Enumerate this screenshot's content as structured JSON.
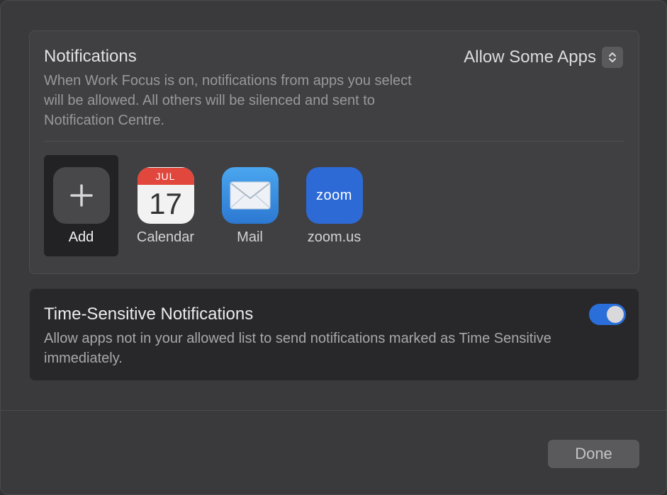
{
  "notifications": {
    "title": "Notifications",
    "description": "When Work Focus is on, notifications from apps you select will be allowed. All others will be silenced and sent to Notification Centre.",
    "mode_label": "Allow Some Apps",
    "apps": [
      {
        "label": "Add",
        "icon": "plus-icon"
      },
      {
        "label": "Calendar",
        "icon": "calendar-icon",
        "month": "JUL",
        "day": "17"
      },
      {
        "label": "Mail",
        "icon": "mail-icon"
      },
      {
        "label": "zoom.us",
        "icon": "zoom-icon",
        "logo_text": "zoom"
      }
    ]
  },
  "time_sensitive": {
    "title": "Time-Sensitive Notifications",
    "description": "Allow apps not in your allowed list to send notifications marked as Time Sensitive immediately.",
    "enabled": true
  },
  "footer": {
    "done_label": "Done"
  },
  "colors": {
    "accent": "#2a6fd9",
    "calendar_red": "#e2473d",
    "zoom_blue": "#2d6ad6"
  }
}
